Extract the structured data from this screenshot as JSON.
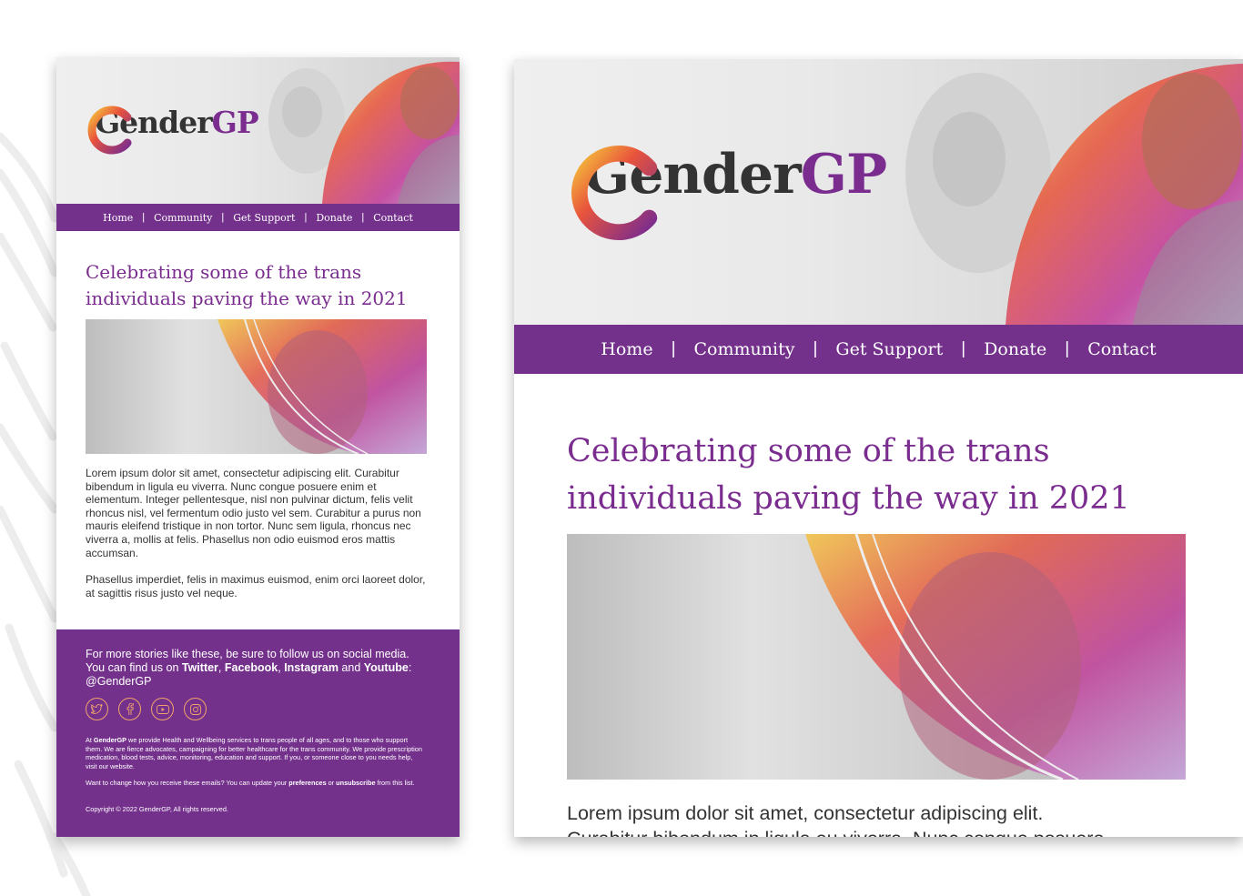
{
  "brand": {
    "name_part1": "Gender",
    "name_part2": "GP",
    "primary_color": "#74318c",
    "text_purple": "#7a2c8f",
    "accent_orange": "#f0a36a"
  },
  "nav": {
    "items": [
      "Home",
      "Community",
      "Get Support",
      "Donate",
      "Contact"
    ],
    "separator": "|"
  },
  "article": {
    "headline_line1": "Celebrating some of the trans",
    "headline_line2": "individuals paving the way in 2021",
    "paragraph1": "Lorem ipsum dolor sit amet, consectetur adipiscing elit. Curabitur bibendum in ligula eu viverra. Nunc congue posuere enim et elementum. Integer pellentesque, nisl non pulvinar dictum, felis velit rhoncus nisl, vel fermentum odio justo vel sem. Curabitur a purus non mauris eleifend tristique in non tortor. Nunc sem ligula, rhoncus nec viverra a, mollis at felis. Phasellus non odio euismod eros mattis accumsan.",
    "paragraph2": "Phasellus imperdiet, felis in maximus euismod, enim orci laoreet dolor, at sagittis risus justo vel neque.",
    "right_preview_line1": "Lorem ipsum dolor sit amet, consectetur adipiscing elit.",
    "right_preview_line2": "Curabitur bibendum in ligula eu viverra. Nunc congue posuere"
  },
  "footer": {
    "follow_prefix": "For more stories like these, be sure to follow us on social media. You can find us on ",
    "twitter": "Twitter",
    "comma1": ", ",
    "facebook": "Facebook",
    "comma2": ", ",
    "instagram": "Instagram",
    "and": " and ",
    "youtube": "Youtube",
    "handle": ": @GenderGP",
    "socials": [
      "twitter-icon",
      "facebook-icon",
      "youtube-icon",
      "instagram-icon"
    ],
    "about_prefix": "At ",
    "about_brand": "GenderGP",
    "about_rest": " we provide Health and Wellbeing services to trans people of all ages, and to those who support them. We are fierce advocates, campaigning for better healthcare for the trans community. We provide prescription medication, blood tests, advice, monitoring, education and support. If you, or someone close to you needs help, visit our website.",
    "prefs_prefix": "Want to change how you receive these emails? You can update your ",
    "prefs_link": "preferences",
    "prefs_or": " or ",
    "unsubscribe_link": "unsubscribe",
    "prefs_suffix": " from this list.",
    "copyright": "Copyright © 2022 GenderGP, All rights reserved."
  }
}
